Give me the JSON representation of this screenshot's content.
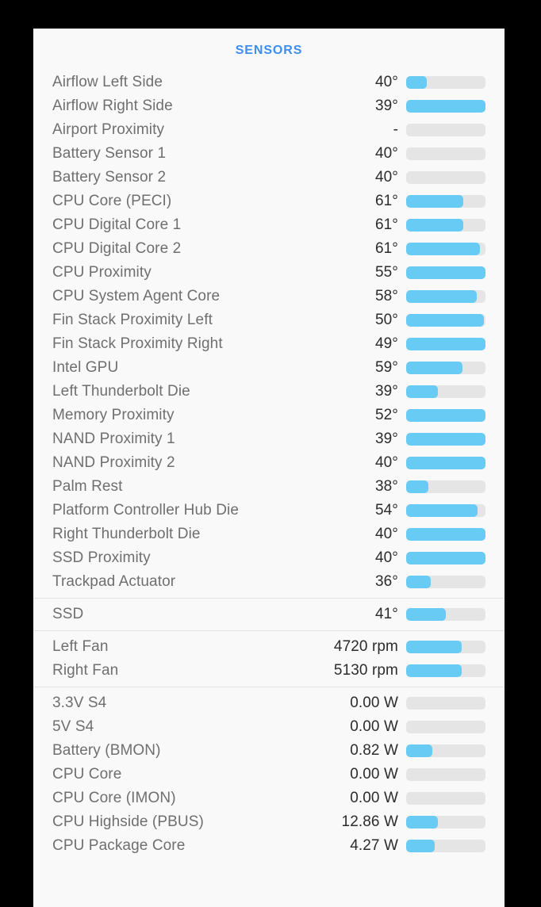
{
  "app": {
    "background_color": "#000000",
    "panel_color": "#f9f9f9",
    "accent_color": "#3c8ef0",
    "bar_fill_color": "#68cbf4",
    "bar_track_color": "#e5e5e5"
  },
  "header": {
    "title": "SENSORS"
  },
  "groups": [
    {
      "name": "temperature-sensors",
      "rows": [
        {
          "label": "Airflow Left Side",
          "value": "40°",
          "percent": 26
        },
        {
          "label": "Airflow Right Side",
          "value": "39°",
          "percent": 100
        },
        {
          "label": "Airport Proximity",
          "value": "-",
          "percent": 0
        },
        {
          "label": "Battery Sensor 1",
          "value": "40°",
          "percent": 0
        },
        {
          "label": "Battery Sensor 2",
          "value": "40°",
          "percent": 0
        },
        {
          "label": "CPU Core (PECI)",
          "value": "61°",
          "percent": 72
        },
        {
          "label": "CPU Digital Core 1",
          "value": "61°",
          "percent": 72
        },
        {
          "label": "CPU Digital Core 2",
          "value": "61°",
          "percent": 93
        },
        {
          "label": "CPU Proximity",
          "value": "55°",
          "percent": 100
        },
        {
          "label": "CPU System Agent Core",
          "value": "58°",
          "percent": 89
        },
        {
          "label": "Fin Stack Proximity Left",
          "value": "50°",
          "percent": 98
        },
        {
          "label": "Fin Stack Proximity Right",
          "value": "49°",
          "percent": 100
        },
        {
          "label": "Intel GPU",
          "value": "59°",
          "percent": 71
        },
        {
          "label": "Left Thunderbolt Die",
          "value": "39°",
          "percent": 40
        },
        {
          "label": "Memory Proximity",
          "value": "52°",
          "percent": 100
        },
        {
          "label": "NAND Proximity 1",
          "value": "39°",
          "percent": 100
        },
        {
          "label": "NAND Proximity 2",
          "value": "40°",
          "percent": 100
        },
        {
          "label": "Palm Rest",
          "value": "38°",
          "percent": 28
        },
        {
          "label": "Platform Controller Hub Die",
          "value": "54°",
          "percent": 90
        },
        {
          "label": "Right Thunderbolt Die",
          "value": "40°",
          "percent": 100
        },
        {
          "label": "SSD Proximity",
          "value": "40°",
          "percent": 100
        },
        {
          "label": "Trackpad Actuator",
          "value": "36°",
          "percent": 31
        }
      ]
    },
    {
      "name": "drive-sensors",
      "rows": [
        {
          "label": "SSD",
          "value": "41°",
          "percent": 50
        }
      ]
    },
    {
      "name": "fan-sensors",
      "rows": [
        {
          "label": "Left Fan",
          "value": "4720 rpm",
          "percent": 70
        },
        {
          "label": "Right Fan",
          "value": "5130 rpm",
          "percent": 70
        }
      ]
    },
    {
      "name": "power-sensors",
      "rows": [
        {
          "label": "3.3V S4",
          "value": "0.00 W",
          "percent": 0
        },
        {
          "label": "5V S4",
          "value": "0.00 W",
          "percent": 0
        },
        {
          "label": "Battery (BMON)",
          "value": "0.82 W",
          "percent": 33
        },
        {
          "label": "CPU Core",
          "value": "0.00 W",
          "percent": 0
        },
        {
          "label": "CPU Core (IMON)",
          "value": "0.00 W",
          "percent": 0
        },
        {
          "label": "CPU Highside (PBUS)",
          "value": "12.86 W",
          "percent": 40
        },
        {
          "label": "CPU Package Core",
          "value": "4.27 W",
          "percent": 36
        }
      ]
    }
  ]
}
